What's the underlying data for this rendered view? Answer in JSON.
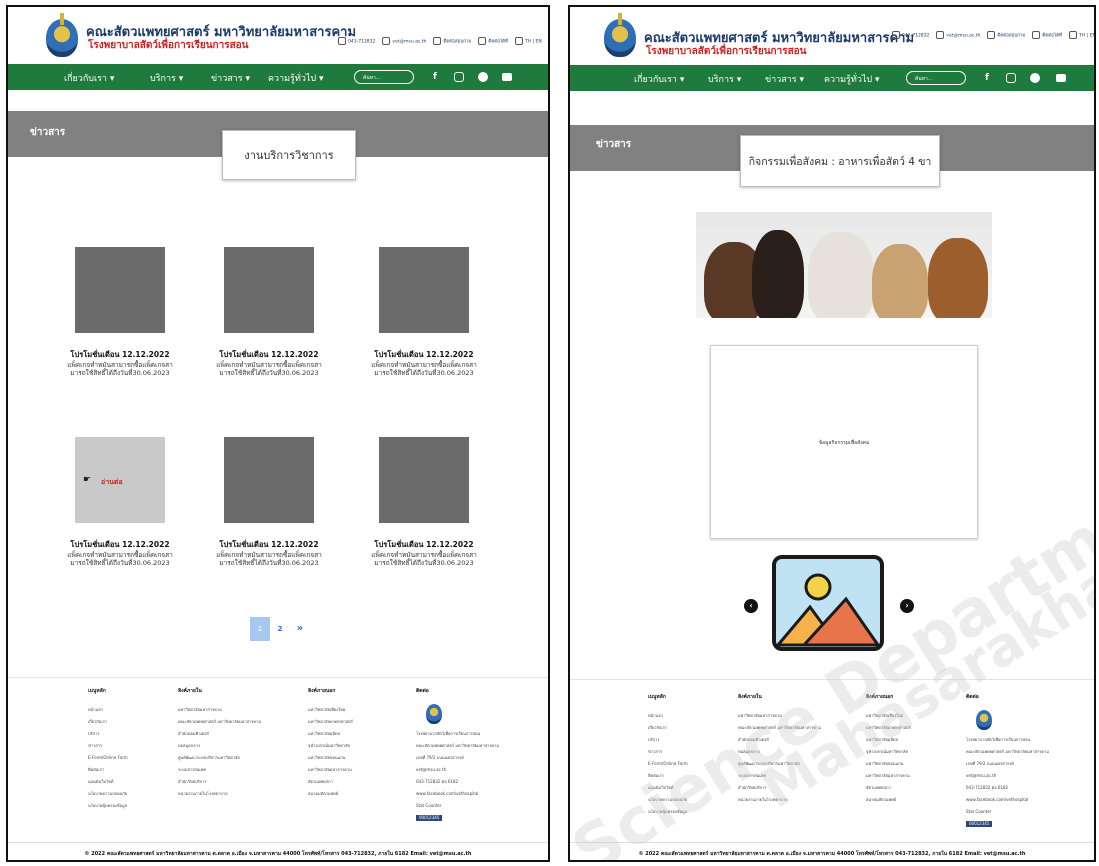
{
  "site": {
    "title": "คณะสัตวแพทยศาสตร์ มหาวิทยาลัยมหาสารคาม",
    "subtitle": "โรงพยาบาลสัตว์เพื่อการเรียนการสอน",
    "phone": "043-712832",
    "email": "vet@msu.ac.th",
    "contact_label": "ติดต่อสอบถาม",
    "map_label": "ติดต่อได้ที่",
    "lang": "TH | EN"
  },
  "nav": {
    "items": [
      "เกี่ยวกับเรา ▾",
      "บริการ ▾",
      "ข่าวสาร ▾",
      "ความรู้ทั่วไป ▾"
    ],
    "search_placeholder": "ค้นหา..."
  },
  "left": {
    "banner_label": "ข่าวสาร",
    "page_title": "งานบริการวิชาการ",
    "cards": [
      {
        "title": "โปรโมชั่นเดือน 12.12.2022",
        "desc1": "แพ็คเกจทำหมันสามารถซื้อแพ็คเกจสา",
        "desc2": "มารถใช้สิทธิ์ได้ถึงวันที่30.06.2023"
      },
      {
        "title": "โปรโมชั่นเดือน 12.12.2022",
        "desc1": "แพ็คเกจทำหมันสามารถซื้อแพ็คเกจสา",
        "desc2": "มารถใช้สิทธิ์ได้ถึงวันที่30.06.2023"
      },
      {
        "title": "โปรโมชั่นเดือน 12.12.2022",
        "desc1": "แพ็คเกจทำหมันสามารถซื้อแพ็คเกจสา",
        "desc2": "มารถใช้สิทธิ์ได้ถึงวันที่30.06.2023"
      },
      {
        "title": "โปรโมชั่นเดือน 12.12.2022",
        "desc1": "แพ็คเกจทำหมันสามารถซื้อแพ็คเกจสา",
        "desc2": "มารถใช้สิทธิ์ได้ถึงวันที่30.06.2023"
      },
      {
        "title": "โปรโมชั่นเดือน 12.12.2022",
        "desc1": "แพ็คเกจทำหมันสามารถซื้อแพ็คเกจสา",
        "desc2": "มารถใช้สิทธิ์ได้ถึงวันที่30.06.2023"
      },
      {
        "title": "โปรโมชั่นเดือน 12.12.2022",
        "desc1": "แพ็คเกจทำหมันสามารถซื้อแพ็คเกจสา",
        "desc2": "มารถใช้สิทธิ์ได้ถึงวันที่30.06.2023"
      }
    ],
    "read_more": "อ่านต่อ",
    "pager": [
      "1",
      "2",
      "»"
    ]
  },
  "right": {
    "banner_label": "ข่าวสาร",
    "page_title": "กิจกรรมเพื่อสังคม : อาหารเพื่อสัตว์ 4 ขา",
    "info_text": "ข้อมูลกิจกรรมเพื่อสังคม",
    "prev": "‹",
    "next": "›"
  },
  "footer": {
    "col1_title": "เมนูหลัก",
    "col1": [
      "หน้าแรก",
      "เกี่ยวกับเรา",
      "บริการ",
      "ข่าวสาร",
      "E-Form/Online Form",
      "ติดต่อเรา",
      "แผนผังเว็บไซต์",
      "นโยบายความปลอดภัย",
      "นโยบายคุ้มครองข้อมูล"
    ],
    "col2_title": "ลิงค์ภายใน",
    "col2": [
      "มหาวิทยาลัยมหาสารคาม",
      "คณะสัตวแพทยศาสตร์ มหาวิทยาลัยมหาสารคาม",
      "สำนักคอมพิวเตอร์",
      "หอสมุดกลาง",
      "ศูนย์พัฒนาระบบบริหารมหาวิทยาลัย",
      "ระบบสารสนเทศ",
      "สำนักวิทยบริการ",
      "หน่วยงานภายในโรงพยาบาล"
    ],
    "col3_title": "ลิงค์ภายนอก",
    "col3": [
      "มหาวิทยาลัยเชียงใหม่",
      "มหาวิทยาลัยเกษตรศาสตร์",
      "มหาวิทยาลัยมหิดล",
      "จุฬาลงกรณ์มหาวิทยาลัย",
      "มหาวิทยาลัยขอนแก่น",
      "มหาวิทยาลัยมหาสารคาม",
      "สัตวแพทยสภา",
      "สมาคมสัตวแพทย์"
    ],
    "col4_title": "ติดต่อ",
    "col4": [
      "โรงพยาบาลสัตว์เพื่อการเรียนการสอน",
      "คณะสัตวแพทยศาสตร์ มหาวิทยาลัยมหาสารคาม",
      "เลขที่ 79/2 ถนนนครสวรรค์",
      "vet@msu.ac.th",
      "043-712832 ต่อ 6182",
      "www.facebook.com/vethospital"
    ],
    "counter_label": "Stat Counter",
    "counter_value": "00012345",
    "copyright": "© 2022 คณะสัตวแพทยศาสตร์ มหาวิทยาลัยมหาสารคาม ต.ตลาด อ.เมือง จ.มหาสารคาม 44000 โทรศัพท์/โทรสาร 043-712832, ภายใน 6182 Email: vet@msu.ac.th"
  },
  "watermark": {
    "line1": "Science Department",
    "line2": "Mahasarakham University"
  },
  "colors": {
    "nav_green": "#1f7a3e",
    "banner_gray": "#818181",
    "title_blue": "#1a3a6b",
    "subtitle_red": "#d11f1f",
    "pager_active": "#a8c8f0"
  }
}
